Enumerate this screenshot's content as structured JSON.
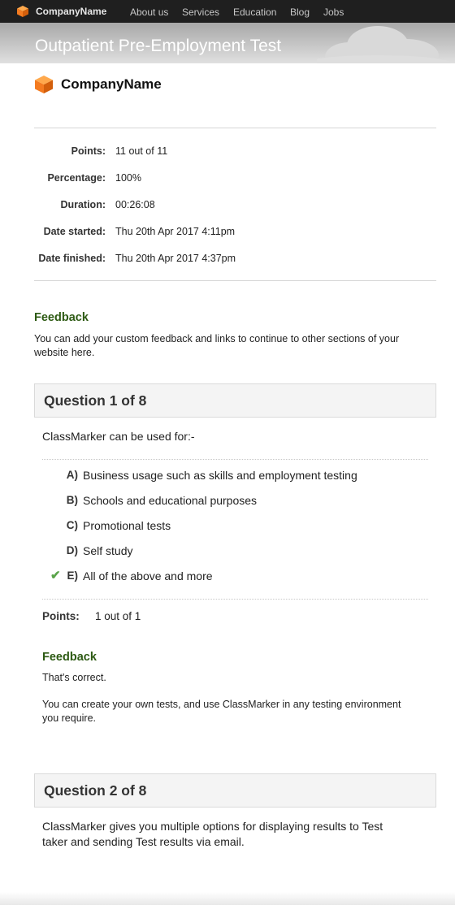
{
  "nav": {
    "brand": "CompanyName",
    "links": [
      "About us",
      "Services",
      "Education",
      "Blog",
      "Jobs"
    ]
  },
  "banner": {
    "title": "Outpatient Pre-Employment Test"
  },
  "brand": {
    "name": "CompanyName"
  },
  "results": [
    {
      "label": "Points:",
      "value": "11 out of 11"
    },
    {
      "label": "Percentage:",
      "value": "100%"
    },
    {
      "label": "Duration:",
      "value": "00:26:08"
    },
    {
      "label": "Date started:",
      "value": "Thu 20th Apr 2017 4:11pm"
    },
    {
      "label": "Date finished:",
      "value": "Thu 20th Apr 2017 4:37pm"
    }
  ],
  "feedback": {
    "title": "Feedback",
    "text_line1": "You can add your custom feedback and links to continue to other sections of your",
    "text_line2": "website here."
  },
  "questions": [
    {
      "header": "Question 1 of 8",
      "text": "ClassMarker can be used for:-",
      "answers": [
        {
          "letter": "A)",
          "text": "Business usage such as skills and employment testing",
          "correct": false
        },
        {
          "letter": "B)",
          "text": "Schools and educational purposes",
          "correct": false
        },
        {
          "letter": "C)",
          "text": "Promotional tests",
          "correct": false
        },
        {
          "letter": "D)",
          "text": "Self study",
          "correct": false
        },
        {
          "letter": "E)",
          "text": "All of the above and more",
          "correct": true
        }
      ],
      "points_label": "Points:",
      "points_value": "1 out of 1",
      "feedback_title": "Feedback",
      "feedback_line1": "That's correct.",
      "feedback_line2": "You can create your own tests, and use ClassMarker in any testing environment",
      "feedback_line3": "you require."
    },
    {
      "header": "Question 2 of 8",
      "text_line1": "ClassMarker gives you multiple options for displaying results to Test",
      "text_line2": "taker and sending Test results via email."
    }
  ],
  "icons": {
    "check": "checkmark-icon",
    "logo": "cube-logo-icon"
  },
  "colors": {
    "accent_green": "#2d5a13",
    "check_green": "#5aa44a",
    "logo_orange": "#f47b20"
  }
}
